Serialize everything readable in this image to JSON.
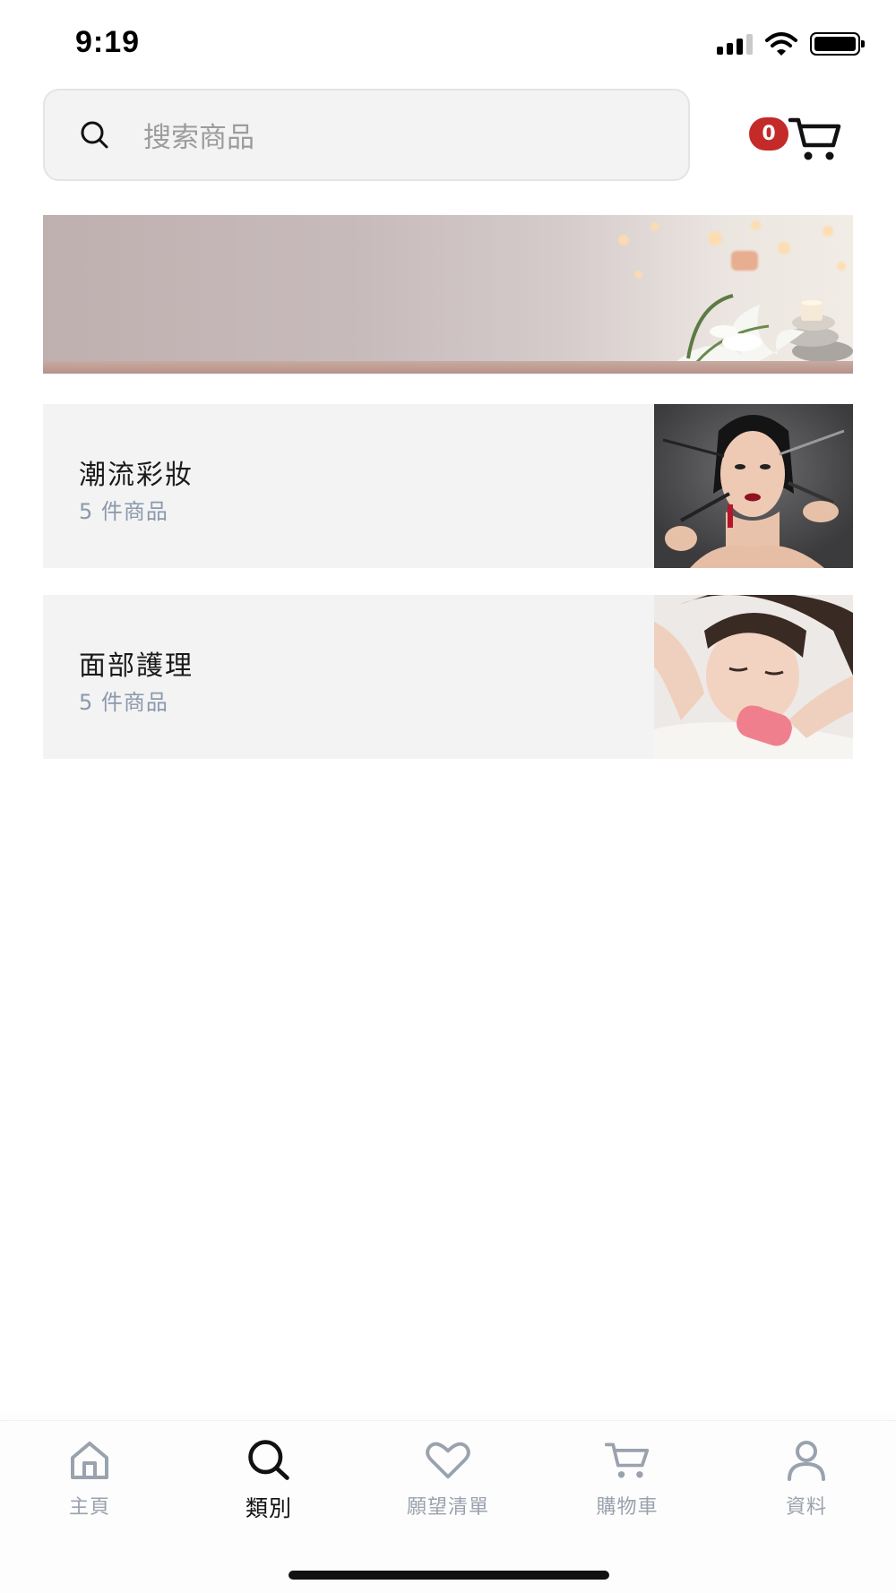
{
  "status_bar": {
    "time": "9:19"
  },
  "search": {
    "placeholder": "搜索商品"
  },
  "cart": {
    "badge_count": "0"
  },
  "categories": [
    {
      "title": "潮流彩妝",
      "count": "5 件商品"
    },
    {
      "title": "面部護理",
      "count": "5 件商品"
    }
  ],
  "tab_bar": {
    "tabs": [
      {
        "label": "主頁",
        "icon": "home-icon"
      },
      {
        "label": "類別",
        "icon": "search-icon",
        "active": true
      },
      {
        "label": "願望清單",
        "icon": "heart-icon"
      },
      {
        "label": "購物車",
        "icon": "cart-icon"
      },
      {
        "label": "資料",
        "icon": "user-icon"
      }
    ]
  },
  "colors": {
    "badge": "#c32a28",
    "card_bg": "#f3f3f3",
    "count_text": "#8b98ad",
    "tab_inactive": "#9aa2ad"
  }
}
